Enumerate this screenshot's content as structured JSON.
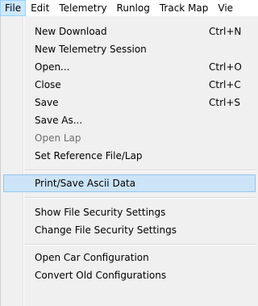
{
  "menubar": {
    "items": [
      {
        "label": "File",
        "active": true
      },
      {
        "label": "Edit"
      },
      {
        "label": "Telemetry"
      },
      {
        "label": "Runlog"
      },
      {
        "label": "Track Map"
      },
      {
        "label": "Vie"
      }
    ]
  },
  "file_menu": {
    "items": [
      {
        "label": "New Download",
        "shortcut": "Ctrl+N"
      },
      {
        "label": "New Telemetry Session"
      },
      {
        "label": "Open...",
        "shortcut": "Ctrl+O"
      },
      {
        "label": "Close",
        "shortcut": "Ctrl+C"
      },
      {
        "label": "Save",
        "shortcut": "Ctrl+S"
      },
      {
        "label": "Save As..."
      },
      {
        "label": "Open Lap",
        "disabled": true
      },
      {
        "label": "Set Reference File/Lap"
      },
      {
        "label": "Print/Save Ascii Data",
        "hovered": true
      },
      {
        "label": "Show File Security Settings"
      },
      {
        "label": "Change File Security Settings"
      },
      {
        "label": "Open Car Configuration"
      },
      {
        "label": "Convert Old Configurations"
      }
    ]
  },
  "colors": {
    "menu_background": "#f0f0f0",
    "hover_background": "#cce4f7",
    "hover_border": "#98c5ea",
    "active_menubar_background": "#cce8ff",
    "disabled_text": "#6d6d6d"
  }
}
